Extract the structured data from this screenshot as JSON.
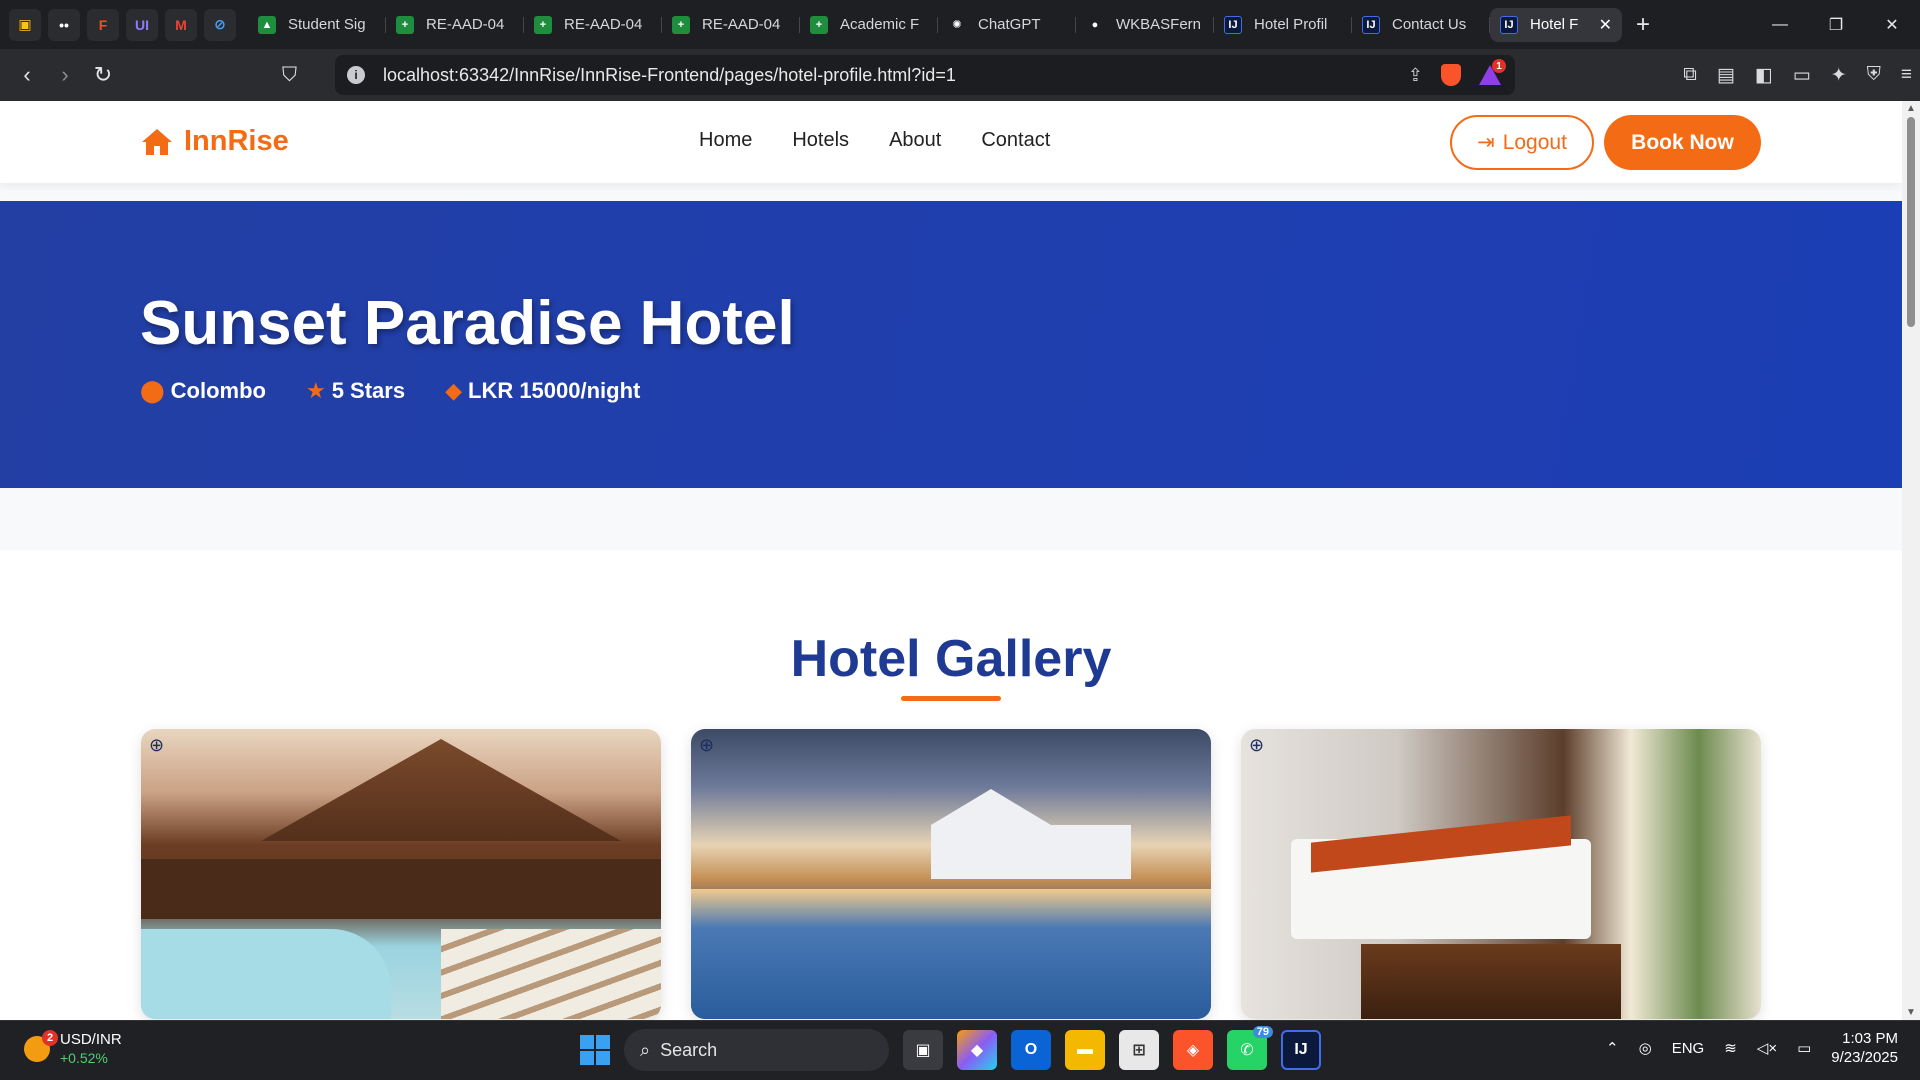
{
  "browser": {
    "tabs": [
      {
        "label": "Student Sig",
        "color": "#1e8e3e",
        "glyph": "▲"
      },
      {
        "label": "RE-AAD-04",
        "color": "#1e8e3e",
        "glyph": "+"
      },
      {
        "label": "RE-AAD-04",
        "color": "#1e8e3e",
        "glyph": "+"
      },
      {
        "label": "RE-AAD-04",
        "color": "#1e8e3e",
        "glyph": "+"
      },
      {
        "label": "Academic F",
        "color": "#1e8e3e",
        "glyph": "+"
      },
      {
        "label": "ChatGPT",
        "color": "#444",
        "glyph": "✺"
      },
      {
        "label": "WKBASFern",
        "color": "#444",
        "glyph": "●"
      },
      {
        "label": "Hotel Profil",
        "color": "#0b3d91",
        "glyph": "IJ"
      },
      {
        "label": "Contact Us",
        "color": "#0b3d91",
        "glyph": "IJ"
      }
    ],
    "active_tab": {
      "label": "Hotel F",
      "close": "✕"
    },
    "new_tab": "+",
    "url": "localhost:63342/InnRise/InnRise-Frontend/pages/hotel-profile.html?id=1",
    "rewards_count": "1",
    "window_controls": {
      "minimize": "—",
      "restore": "❐",
      "close": "✕"
    }
  },
  "site": {
    "brand": "InnRise",
    "nav": [
      "Home",
      "Hotels",
      "About",
      "Contact"
    ],
    "logout_label": "Logout",
    "book_label": "Book Now",
    "brand_color": "#f46b15",
    "hero_color": "#1f3fb0"
  },
  "hotel": {
    "name": "Sunset Paradise Hotel",
    "location": "Colombo",
    "rating": "5 Stars",
    "price": "LKR 15000/night"
  },
  "gallery": {
    "title": "Hotel Gallery",
    "photos": [
      "pool-deck-photo",
      "poolside-restaurant-photo",
      "bedroom-photo"
    ]
  },
  "taskbar": {
    "ticker": "USD/INR",
    "ticker_change": "+0.52%",
    "ticker_badge": "2",
    "search_placeholder": "Search",
    "whatsapp_badge": "79",
    "lang": "ENG",
    "time": "1:03 PM",
    "date": "9/23/2025"
  }
}
